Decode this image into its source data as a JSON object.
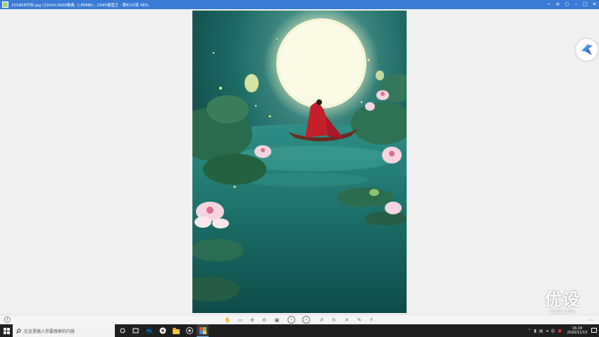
{
  "window": {
    "title": "201808中秋.jpg  (1910×2600像素, 1.89MB) - 2345看图王 - 第8/10张 48%",
    "controls": [
      "minimize-to-tray",
      "settings",
      "pin",
      "minimize",
      "maximize",
      "close"
    ]
  },
  "viewer": {
    "image_description_name": "mid-autumn-moon-lotus-pond",
    "toolbar_icons": [
      "hand-icon",
      "fit-icon",
      "zoom-in-icon",
      "zoom-out-icon",
      "actual-size-icon",
      "prev-icon",
      "next-icon",
      "rotate-left-icon",
      "rotate-right-icon",
      "delete-icon",
      "edit-icon",
      "upload-icon"
    ],
    "info_icon": "info-icon",
    "right_icon": "feedback-icon"
  },
  "watermark": {
    "main": "优设",
    "sub": "uisdc.com"
  },
  "taskbar": {
    "search_placeholder": "在这里输入你要搜索的内容",
    "apps": [
      "cortana-icon",
      "task-view-icon",
      "photoshop-icon",
      "app-icon",
      "file-explorer-icon",
      "chrome-icon",
      "image-viewer-icon"
    ],
    "tray": {
      "ime": "中",
      "time": "16:18",
      "date": "2020/11/15"
    }
  },
  "colors": {
    "titlebar": "#3a7bd5",
    "taskbar": "#1f1f1f",
    "pond": "#0f4a48"
  }
}
